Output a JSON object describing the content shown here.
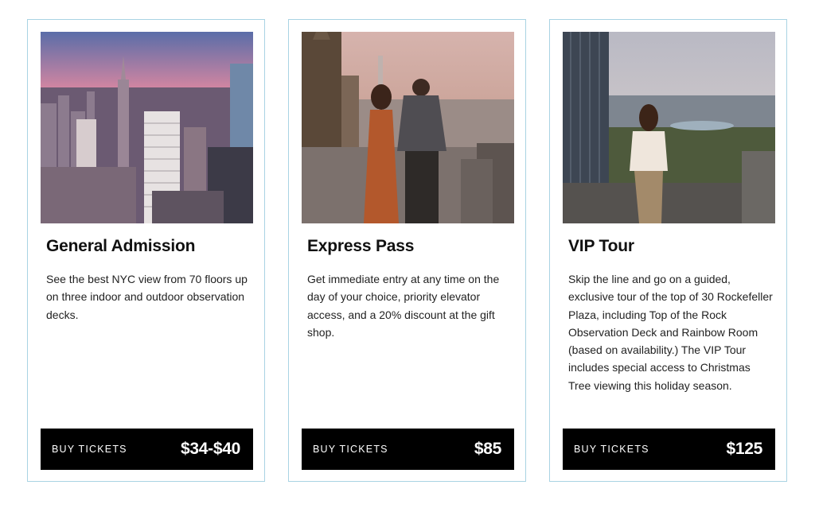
{
  "cards": [
    {
      "title": "General Admission",
      "description": "See the best NYC view from 70 floors up on three indoor and outdoor observation decks.",
      "buy_label": "BUY TICKETS",
      "price": "$34-$40",
      "image_icon": "city-skyline-sunset-photo"
    },
    {
      "title": "Express Pass",
      "description": "Get immediate entry at any time on the day of your choice, priority elevator access, and a 20% discount at the gift shop.",
      "buy_label": "BUY TICKETS",
      "price": "$85",
      "image_icon": "couple-overlook-photo"
    },
    {
      "title": "VIP Tour",
      "description": "Skip the line and go on a guided, exclusive tour of the top of 30 Rockefeller Plaza, including Top of the Rock Observation Deck and Rainbow Room (based on availability.) The VIP Tour includes special access to Christmas Tree viewing this holiday season.",
      "buy_label": "BUY TICKETS",
      "price": "$125",
      "image_icon": "woman-central-park-view-photo"
    }
  ],
  "colors": {
    "card_border": "#a9d3e3",
    "buy_bar_bg": "#000000",
    "buy_bar_text": "#ffffff"
  }
}
